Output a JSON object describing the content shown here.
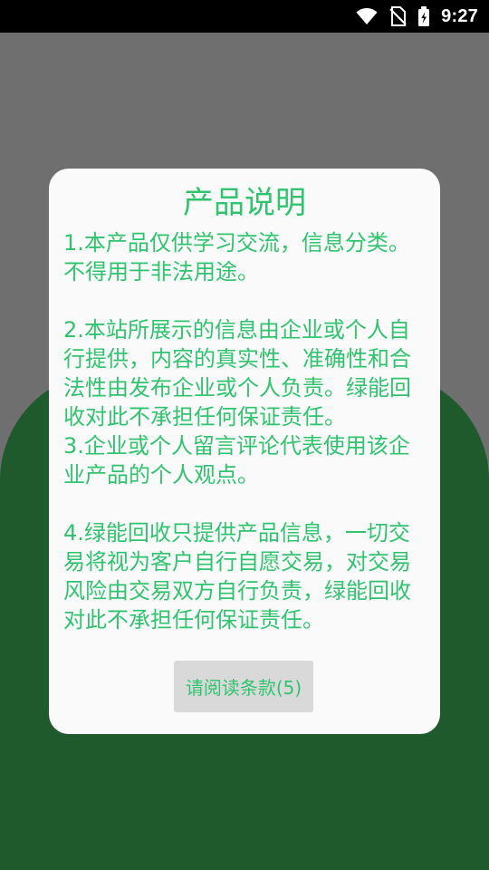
{
  "status_bar": {
    "time": "9:27",
    "icons": [
      "wifi-icon",
      "no-sim-icon",
      "battery-charging-icon"
    ]
  },
  "dialog": {
    "title": "产品说明",
    "body": "1.本产品仅供学习交流，信息分类。不得用于非法用途。\n\n2.本站所展示的信息由企业或个人自行提供，内容的真实性、准确性和合法性由发布企业或个人负责。绿能回收对此不承担任何保证责任。\n3.企业或个人留言评论代表使用该企业产品的个人观点。\n\n4.绿能回收只提供产品信息，一切交易将视为客户自行自愿交易，对交易风险由交易双方自行负责，绿能回收对此不承担任何保证责任。",
    "button_label": "请阅读条款(5)"
  },
  "colors": {
    "overlay": "#6f6f6f",
    "green": "#1e5a2b",
    "accent_text": "#31c46f",
    "dialog_bg": "#fafafa",
    "button_bg": "#d9d9d9"
  }
}
